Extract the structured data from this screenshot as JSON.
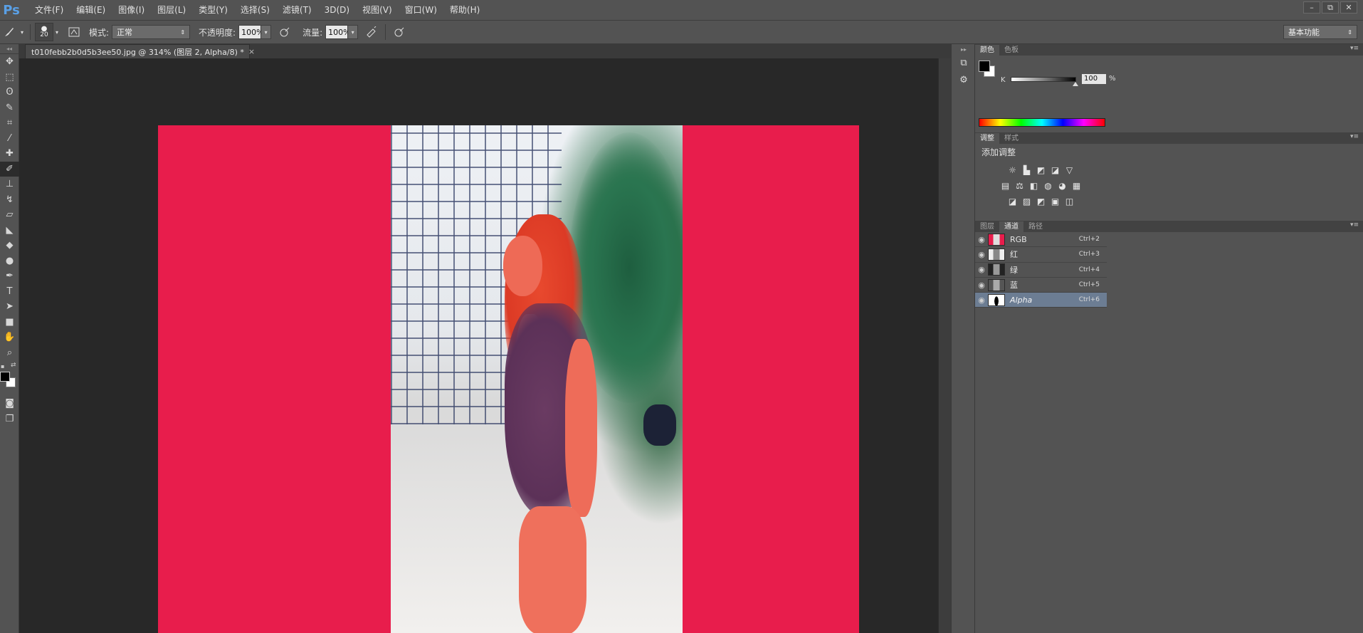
{
  "app": {
    "logo": "Ps"
  },
  "menu": [
    "文件(F)",
    "编辑(E)",
    "图像(I)",
    "图层(L)",
    "类型(Y)",
    "选择(S)",
    "滤镜(T)",
    "3D(D)",
    "视图(V)",
    "窗口(W)",
    "帮助(H)"
  ],
  "window_controls": {
    "minimize": "–",
    "restore": "⧉",
    "close": "✕"
  },
  "options": {
    "brush_size": "20",
    "mode_label": "模式:",
    "mode_value": "正常",
    "opacity_label": "不透明度:",
    "opacity_value": "100%",
    "flow_label": "流量:",
    "flow_value": "100%",
    "workspace": "基本功能"
  },
  "document": {
    "tab_title": "t010febb2b0d5b3ee50.jpg @ 314% (图层 2, Alpha/8) *",
    "close": "×"
  },
  "colors": {
    "canvas_red": "#e81d4c",
    "selected_row": "#6c7d93",
    "panel_bg": "#535353"
  },
  "color_panel": {
    "tabs": [
      "颜色",
      "色板"
    ],
    "k_label": "K",
    "k_value": "100",
    "unit": "%",
    "k_level": 1.0
  },
  "adjust_panel": {
    "tabs": [
      "调整",
      "样式"
    ],
    "title": "添加调整",
    "row1": [
      "☼",
      "▙",
      "◩",
      "◪",
      "▽"
    ],
    "row2": [
      "▤",
      "⚖",
      "◧",
      "◍",
      "◕",
      "▦"
    ],
    "row3": [
      "◪",
      "▨",
      "◩",
      "▣",
      "◫"
    ]
  },
  "channels_panel": {
    "tabs": [
      "图层",
      "通道",
      "路径"
    ],
    "rows": [
      {
        "name": "RGB",
        "shortcut": "Ctrl+2"
      },
      {
        "name": "红",
        "shortcut": "Ctrl+3"
      },
      {
        "name": "绿",
        "shortcut": "Ctrl+4"
      },
      {
        "name": "蓝",
        "shortcut": "Ctrl+5"
      },
      {
        "name": "Alpha",
        "shortcut": "Ctrl+6"
      }
    ]
  },
  "tools": [
    "move-icon",
    "marquee-icon",
    "lasso-icon",
    "quick-select-icon",
    "crop-icon",
    "eyedropper-icon",
    "healing-icon",
    "brush-icon",
    "stamp-icon",
    "history-brush-icon",
    "eraser-icon",
    "gradient-icon",
    "blur-icon",
    "dodge-icon",
    "pen-icon",
    "type-icon",
    "path-select-icon",
    "shape-icon",
    "hand-icon",
    "zoom-icon"
  ]
}
